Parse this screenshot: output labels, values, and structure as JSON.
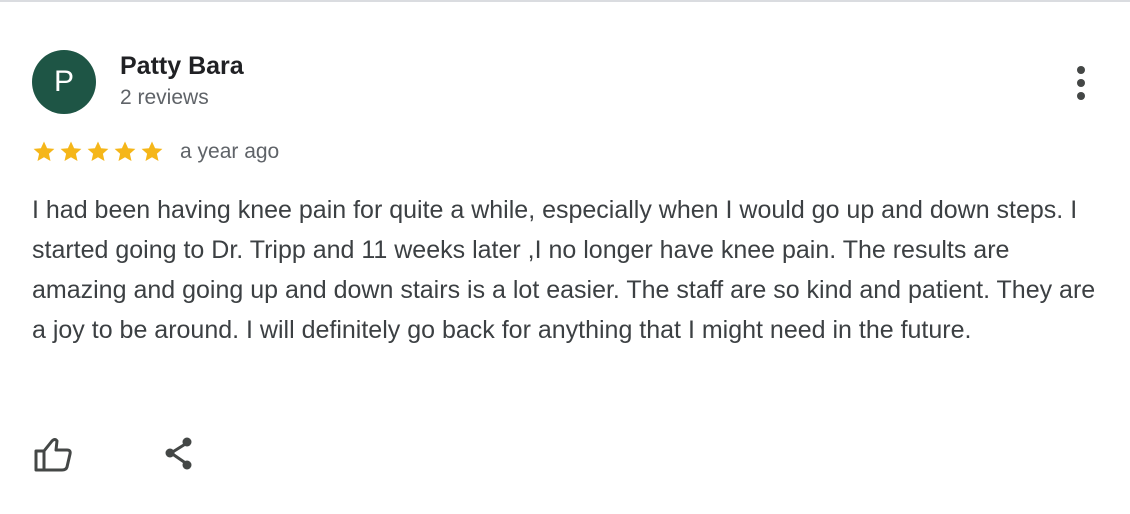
{
  "review": {
    "avatar_initial": "P",
    "author_name": "Patty Bara",
    "review_count": "2 reviews",
    "rating": 5,
    "rating_max": 5,
    "time_ago": "a year ago",
    "text": "I had been having knee pain for quite a while, especially when I would go up and down steps. I started going to Dr. Tripp and 11 weeks later ,I no longer have knee pain. The results are amazing and going up and down stairs is a lot easier. The staff are so kind and patient. They are a joy to be around. I will definitely go back for anything that I might need in the future."
  },
  "icons": {
    "more": "more-vertical-icon",
    "like": "thumb-up-icon",
    "share": "share-icon",
    "star": "star-icon"
  },
  "colors": {
    "avatar_bg": "#1e5545",
    "star": "#f5b619",
    "name": "#202124",
    "secondary_text": "#5f6368",
    "body_text": "#3c4043",
    "icon": "#444746"
  }
}
